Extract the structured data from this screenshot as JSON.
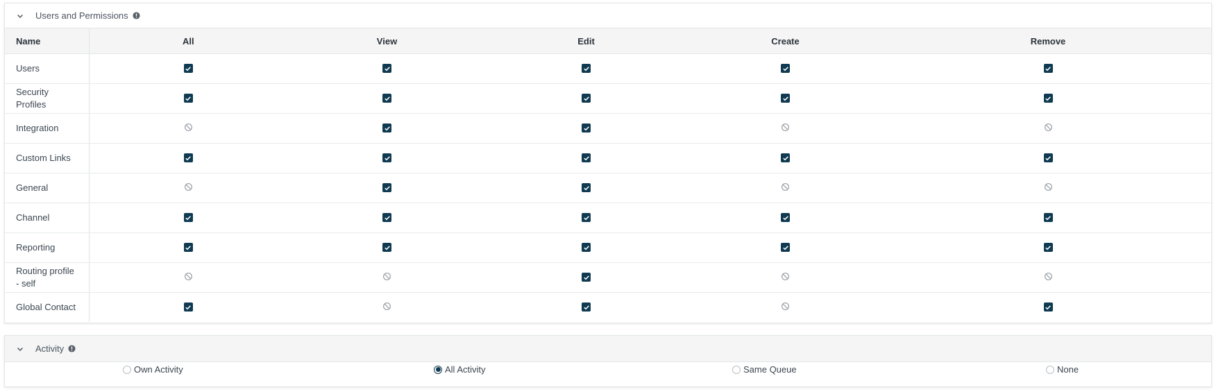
{
  "permissions": {
    "title": "Users and Permissions",
    "columns": [
      "Name",
      "All",
      "View",
      "Edit",
      "Create",
      "Remove"
    ],
    "rows": [
      {
        "name": "Users",
        "cells": [
          "check",
          "check",
          "check",
          "check",
          "check"
        ]
      },
      {
        "name": "Security Profiles",
        "cells": [
          "check",
          "check",
          "check",
          "check",
          "check"
        ]
      },
      {
        "name": "Integration",
        "cells": [
          "na",
          "check",
          "check",
          "na",
          "na"
        ]
      },
      {
        "name": "Custom Links",
        "cells": [
          "check",
          "check",
          "check",
          "check",
          "check"
        ]
      },
      {
        "name": "General",
        "cells": [
          "na",
          "check",
          "check",
          "na",
          "na"
        ]
      },
      {
        "name": "Channel",
        "cells": [
          "check",
          "check",
          "check",
          "check",
          "check"
        ]
      },
      {
        "name": "Reporting",
        "cells": [
          "check",
          "check",
          "check",
          "check",
          "check"
        ]
      },
      {
        "name": "Routing profile - self",
        "cells": [
          "na",
          "na",
          "check",
          "na",
          "na"
        ]
      },
      {
        "name": "Global Contact",
        "cells": [
          "check",
          "na",
          "check",
          "na",
          "check"
        ]
      }
    ]
  },
  "activity": {
    "title": "Activity",
    "options": [
      {
        "label": "Own Activity",
        "selected": false
      },
      {
        "label": "All Activity",
        "selected": true
      },
      {
        "label": "Same Queue",
        "selected": false
      },
      {
        "label": "None",
        "selected": false
      }
    ]
  },
  "icons": {
    "checked": "checkbox-checked-icon",
    "not_applicable": "not-allowed-icon",
    "collapse": "chevron-down-icon",
    "info": "info-icon"
  },
  "colors": {
    "accent": "#0f3a51",
    "header_bg": "#f5f5f5",
    "border": "#e3e5e8"
  }
}
